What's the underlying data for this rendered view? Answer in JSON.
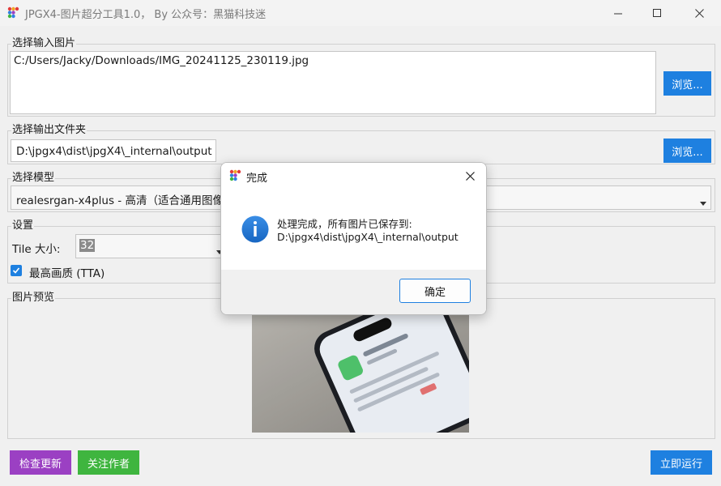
{
  "window": {
    "title": "JPGX4-图片超分工具1.0， By 公众号：黑猫科技迷"
  },
  "input_group": {
    "label": "选择输入图片",
    "value": "C:/Users/Jacky/Downloads/IMG_20241125_230119.jpg",
    "browse_label": "浏览..."
  },
  "output_group": {
    "label": "选择输出文件夹",
    "value": "D:\\jpgx4\\dist\\jpgX4\\_internal\\output",
    "browse_label": "浏览..."
  },
  "model_group": {
    "label": "选择模型",
    "selected": "realesrgan-x4plus - 高清（适合通用图像)"
  },
  "settings_group": {
    "label": "设置",
    "tile_label": "Tile 大小:",
    "tile_value": "32",
    "tta_label": "最高画质 (TTA)",
    "tta_checked": true
  },
  "preview_group": {
    "label": "图片预览"
  },
  "bottom": {
    "check_update": "检查更新",
    "follow_author": "关注作者",
    "run_now": "立即运行"
  },
  "dialog": {
    "title": "完成",
    "message_line1": "处理完成，所有图片已保存到:",
    "message_line2": "D:\\jpgx4\\dist\\jpgX4\\_internal\\output",
    "ok_label": "确定"
  },
  "colors": {
    "accent_blue": "#1e80e0",
    "purple": "#9b40c3",
    "green": "#3fb53f"
  }
}
